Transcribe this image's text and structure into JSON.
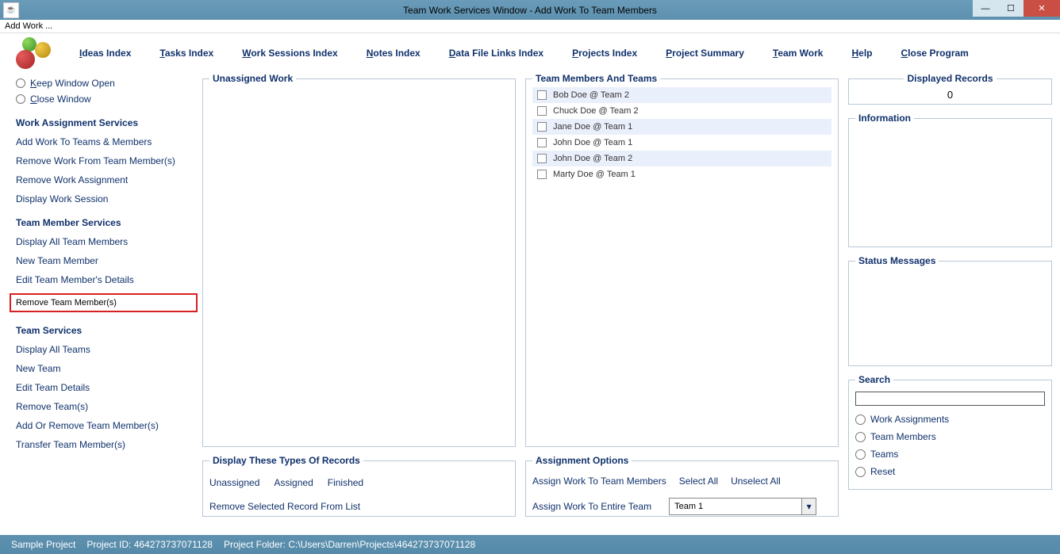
{
  "window_title": "Team Work Services Window - Add Work To Team Members",
  "addwork_label": "Add Work ...",
  "menu": {
    "ideas": "deas Index",
    "tasks": "asks Index",
    "work": "ork Sessions Index",
    "notes": "otes Index",
    "data": "ata File Links Index",
    "projects": "rojects Index",
    "summary": "roject Summary",
    "team": "eam Work",
    "help": "elp",
    "close": "lose Program"
  },
  "sidebar": {
    "keep": "eep Window Open",
    "close": "lose Window",
    "head1": "Work Assignment Services",
    "h1_links": [
      "Add Work To Teams & Members",
      "Remove Work From Team Member(s)",
      "Remove Work Assignment",
      "Display Work Session"
    ],
    "head2": "Team Member Services",
    "h2_links": [
      "Display All Team Members",
      "New Team Member",
      "Edit Team Member's Details"
    ],
    "h2_highlight": "Remove Team Member(s)",
    "head3": "Team Services",
    "h3_links": [
      "Display All Teams",
      "New Team",
      "Edit Team Details",
      "Remove Team(s)",
      "Add Or Remove Team Member(s)",
      "Transfer Team Member(s)"
    ]
  },
  "panels": {
    "unassigned": "Unassigned Work",
    "displaytypes": "Display These Types Of Records",
    "dt_links": [
      "Unassigned",
      "Assigned",
      "Finished"
    ],
    "dt_remove": "Remove Selected Record From List",
    "teams": "Team Members And Teams",
    "members": [
      "Bob Doe @ Team 2",
      "Chuck Doe @ Team 2",
      "Jane Doe @ Team 1",
      "John Doe @ Team 1",
      "John Doe @ Team 2",
      "Marty Doe @ Team 1"
    ],
    "assign_opts": "Assignment Options",
    "ao_links": [
      "Assign Work To Team Members",
      "Select All",
      "Unselect All"
    ],
    "ao_label2": "Assign Work To Entire Team",
    "team_selected": "Team 1",
    "disprec": "Displayed Records",
    "disprec_val": "0",
    "info": "Information",
    "status": "Status Messages",
    "search": "Search",
    "search_opts": [
      "Work Assignments",
      "Team Members",
      "Teams",
      "Reset"
    ]
  },
  "statusbar": {
    "project": "Sample Project",
    "pid_label": "Project ID:  464273737071128",
    "folder": "Project Folder: C:\\Users\\Darren\\Projects\\464273737071128"
  }
}
